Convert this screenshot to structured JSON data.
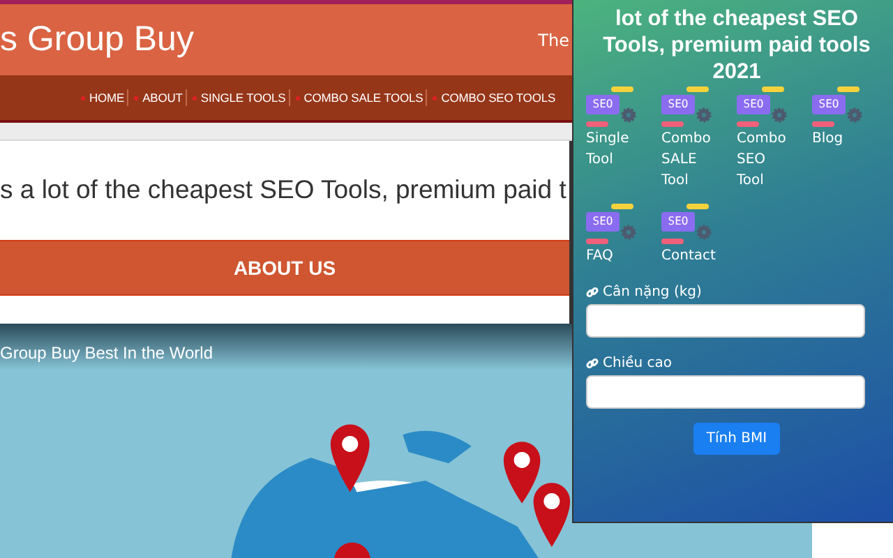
{
  "site": {
    "title": "s Group Buy",
    "tagline": "The"
  },
  "nav": [
    {
      "label": "HOME"
    },
    {
      "label": "ABOUT"
    },
    {
      "label": "SINGLE TOOLS"
    },
    {
      "label": "COMBO SALE TOOLS"
    },
    {
      "label": "COMBO SEO TOOLS"
    }
  ],
  "intro": "s a lot of the cheapest SEO Tools, premium paid t",
  "about_button": "ABOUT US",
  "video": {
    "title": "Group Buy Best In the World"
  },
  "popup": {
    "heading": "lot of the cheapest SEO Tools, premium paid tools 2021",
    "tools": [
      {
        "label": "Single Tool",
        "badge": "SEO"
      },
      {
        "label": "Combo SALE Tool",
        "badge": "SEO"
      },
      {
        "label": "Combo SEO Tool",
        "badge": "SEO"
      },
      {
        "label": "Blog",
        "badge": "SEO"
      },
      {
        "label": "FAQ",
        "badge": "SEO"
      },
      {
        "label": "Contact",
        "badge": "SEO"
      }
    ],
    "fields": [
      {
        "label": "Cân nặng (kg)"
      },
      {
        "label": "Chiều cao"
      }
    ],
    "button": "Tính BMI"
  }
}
